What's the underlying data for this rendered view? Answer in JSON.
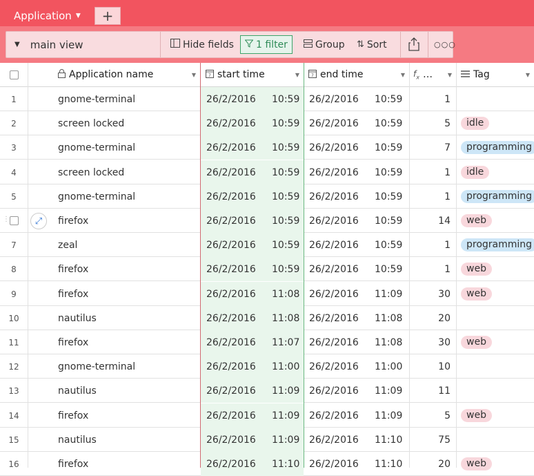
{
  "tabs": {
    "active": "Application",
    "add": "+"
  },
  "toolbar": {
    "view": "main view",
    "hide_fields": "Hide fields",
    "filter": "1 filter",
    "group": "Group",
    "sort": "Sort",
    "share_icon": "share-icon",
    "more_icon": "more-icon"
  },
  "columns": {
    "name": "Application name",
    "start": "start time",
    "end": "end time",
    "duration": "…",
    "tag": "Tag"
  },
  "rows": [
    {
      "n": "1",
      "name": "gnome-terminal",
      "sd": "26/2/2016",
      "st": "10:59",
      "ed": "26/2/2016",
      "et": "10:59",
      "dur": "1",
      "tag": ""
    },
    {
      "n": "2",
      "name": "screen locked",
      "sd": "26/2/2016",
      "st": "10:59",
      "ed": "26/2/2016",
      "et": "10:59",
      "dur": "5",
      "tag": "idle"
    },
    {
      "n": "3",
      "name": "gnome-terminal",
      "sd": "26/2/2016",
      "st": "10:59",
      "ed": "26/2/2016",
      "et": "10:59",
      "dur": "7",
      "tag": "programming"
    },
    {
      "n": "4",
      "name": "screen locked",
      "sd": "26/2/2016",
      "st": "10:59",
      "ed": "26/2/2016",
      "et": "10:59",
      "dur": "1",
      "tag": "idle"
    },
    {
      "n": "5",
      "name": "gnome-terminal",
      "sd": "26/2/2016",
      "st": "10:59",
      "ed": "26/2/2016",
      "et": "10:59",
      "dur": "1",
      "tag": "programming"
    },
    {
      "n": "",
      "name": "firefox",
      "sd": "26/2/2016",
      "st": "10:59",
      "ed": "26/2/2016",
      "et": "10:59",
      "dur": "14",
      "tag": "web"
    },
    {
      "n": "7",
      "name": "zeal",
      "sd": "26/2/2016",
      "st": "10:59",
      "ed": "26/2/2016",
      "et": "10:59",
      "dur": "1",
      "tag": "programming"
    },
    {
      "n": "8",
      "name": "firefox",
      "sd": "26/2/2016",
      "st": "10:59",
      "ed": "26/2/2016",
      "et": "10:59",
      "dur": "1",
      "tag": "web"
    },
    {
      "n": "9",
      "name": "firefox",
      "sd": "26/2/2016",
      "st": "11:08",
      "ed": "26/2/2016",
      "et": "11:09",
      "dur": "30",
      "tag": "web"
    },
    {
      "n": "10",
      "name": "nautilus",
      "sd": "26/2/2016",
      "st": "11:08",
      "ed": "26/2/2016",
      "et": "11:08",
      "dur": "20",
      "tag": ""
    },
    {
      "n": "11",
      "name": "firefox",
      "sd": "26/2/2016",
      "st": "11:07",
      "ed": "26/2/2016",
      "et": "11:08",
      "dur": "30",
      "tag": "web"
    },
    {
      "n": "12",
      "name": "gnome-terminal",
      "sd": "26/2/2016",
      "st": "11:00",
      "ed": "26/2/2016",
      "et": "11:00",
      "dur": "10",
      "tag": ""
    },
    {
      "n": "13",
      "name": "nautilus",
      "sd": "26/2/2016",
      "st": "11:09",
      "ed": "26/2/2016",
      "et": "11:09",
      "dur": "11",
      "tag": ""
    },
    {
      "n": "14",
      "name": "firefox",
      "sd": "26/2/2016",
      "st": "11:09",
      "ed": "26/2/2016",
      "et": "11:09",
      "dur": "5",
      "tag": "web"
    },
    {
      "n": "15",
      "name": "nautilus",
      "sd": "26/2/2016",
      "st": "11:09",
      "ed": "26/2/2016",
      "et": "11:10",
      "dur": "75",
      "tag": ""
    },
    {
      "n": "16",
      "name": "firefox",
      "sd": "26/2/2016",
      "st": "11:10",
      "ed": "26/2/2016",
      "et": "11:10",
      "dur": "20",
      "tag": "web"
    }
  ],
  "colors": {
    "brand": "#f2545f",
    "toolbar": "#f57a82",
    "filter": "#2e8b57",
    "start_col_bg": "#e9f6ec"
  }
}
